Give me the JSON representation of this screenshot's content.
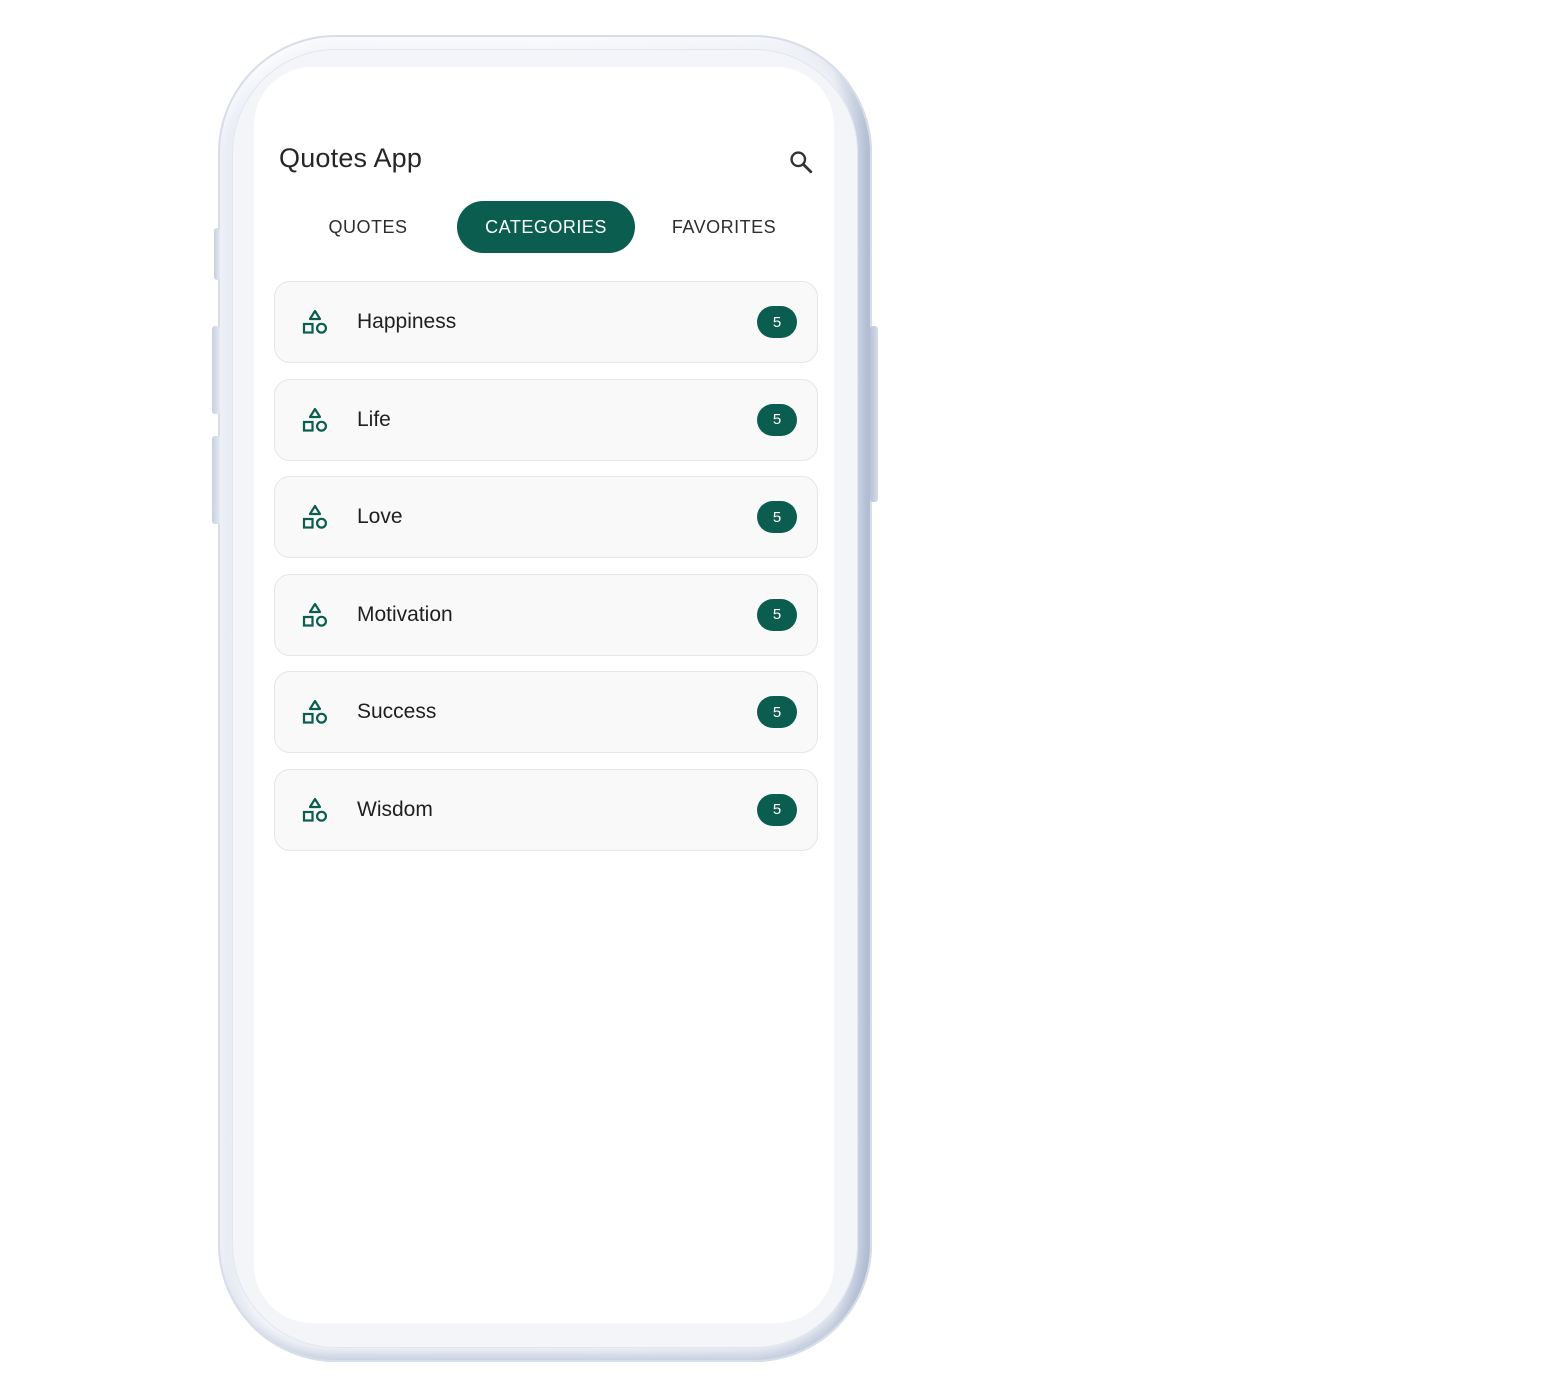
{
  "app": {
    "title": "Quotes App",
    "search_icon": "search-icon",
    "accent_color": "#0b5d4f"
  },
  "tabs": [
    {
      "label": "QUOTES",
      "active": false
    },
    {
      "label": "CATEGORIES",
      "active": true
    },
    {
      "label": "FAVORITES",
      "active": false
    }
  ],
  "categories": [
    {
      "label": "Happiness",
      "count": "5",
      "icon": "category-shapes-icon"
    },
    {
      "label": "Life",
      "count": "5",
      "icon": "category-shapes-icon"
    },
    {
      "label": "Love",
      "count": "5",
      "icon": "category-shapes-icon"
    },
    {
      "label": "Motivation",
      "count": "5",
      "icon": "category-shapes-icon"
    },
    {
      "label": "Success",
      "count": "5",
      "icon": "category-shapes-icon"
    },
    {
      "label": "Wisdom",
      "count": "5",
      "icon": "category-shapes-icon"
    }
  ]
}
